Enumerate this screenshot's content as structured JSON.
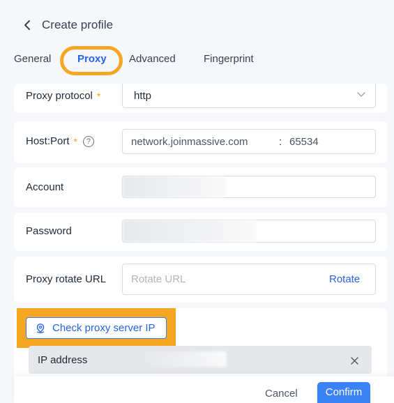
{
  "header": {
    "title": "Create profile"
  },
  "tabs": [
    {
      "label": "General"
    },
    {
      "label": "Proxy"
    },
    {
      "label": "Advanced"
    },
    {
      "label": "Fingerprint"
    }
  ],
  "form": {
    "protocol": {
      "label": "Proxy protocol",
      "required_mark": "*",
      "value": "http"
    },
    "hostport": {
      "label": "Host:Port",
      "required_mark": "*",
      "help": "?",
      "host": "network.joinmassive.com",
      "separator": ":",
      "port": "65534"
    },
    "account": {
      "label": "Account"
    },
    "password": {
      "label": "Password"
    },
    "rotate": {
      "label": "Proxy rotate URL",
      "placeholder": "Rotate URL",
      "action": "Rotate"
    }
  },
  "check": {
    "label": "Check proxy server IP"
  },
  "ip": {
    "label": "IP address"
  },
  "footer": {
    "cancel": "Cancel",
    "confirm": "Confirm"
  },
  "colors": {
    "accent": "#3b82f6",
    "highlight": "#f5a623",
    "required": "#f59e0b"
  }
}
